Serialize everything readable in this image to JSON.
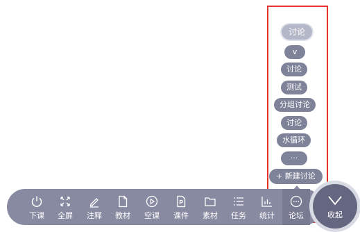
{
  "discussion_menu": {
    "items": [
      {
        "label": "讨论",
        "selected": true
      },
      {
        "label": "v"
      },
      {
        "label": "讨论"
      },
      {
        "label": "测试"
      },
      {
        "label": "分组讨论"
      },
      {
        "label": "讨论"
      },
      {
        "label": "水循环"
      },
      {
        "label": "···"
      }
    ],
    "new_button_label": "+ 新建讨论"
  },
  "toolbar": {
    "items": [
      {
        "label": "下课",
        "icon": "power-icon"
      },
      {
        "label": "全屏",
        "icon": "fullscreen-icon"
      },
      {
        "label": "注释",
        "icon": "pen-icon"
      },
      {
        "label": "教材",
        "icon": "document-icon"
      },
      {
        "label": "空课",
        "icon": "play-icon"
      },
      {
        "label": "课件",
        "icon": "ppt-file-icon"
      },
      {
        "label": "素材",
        "icon": "folder-icon"
      },
      {
        "label": "任务",
        "icon": "list-icon"
      },
      {
        "label": "统计",
        "icon": "bar-chart-icon"
      },
      {
        "label": "论坛",
        "icon": "chat-icon",
        "active": true
      }
    ],
    "collapse_label": "收起"
  },
  "colors": {
    "toolbar_bg": "#878aa0",
    "pill_bg": "#7f8399",
    "selected_pill_bg": "#b4b7c8",
    "collapse_bg": "#64677f",
    "highlight_frame": "#e5322d"
  }
}
